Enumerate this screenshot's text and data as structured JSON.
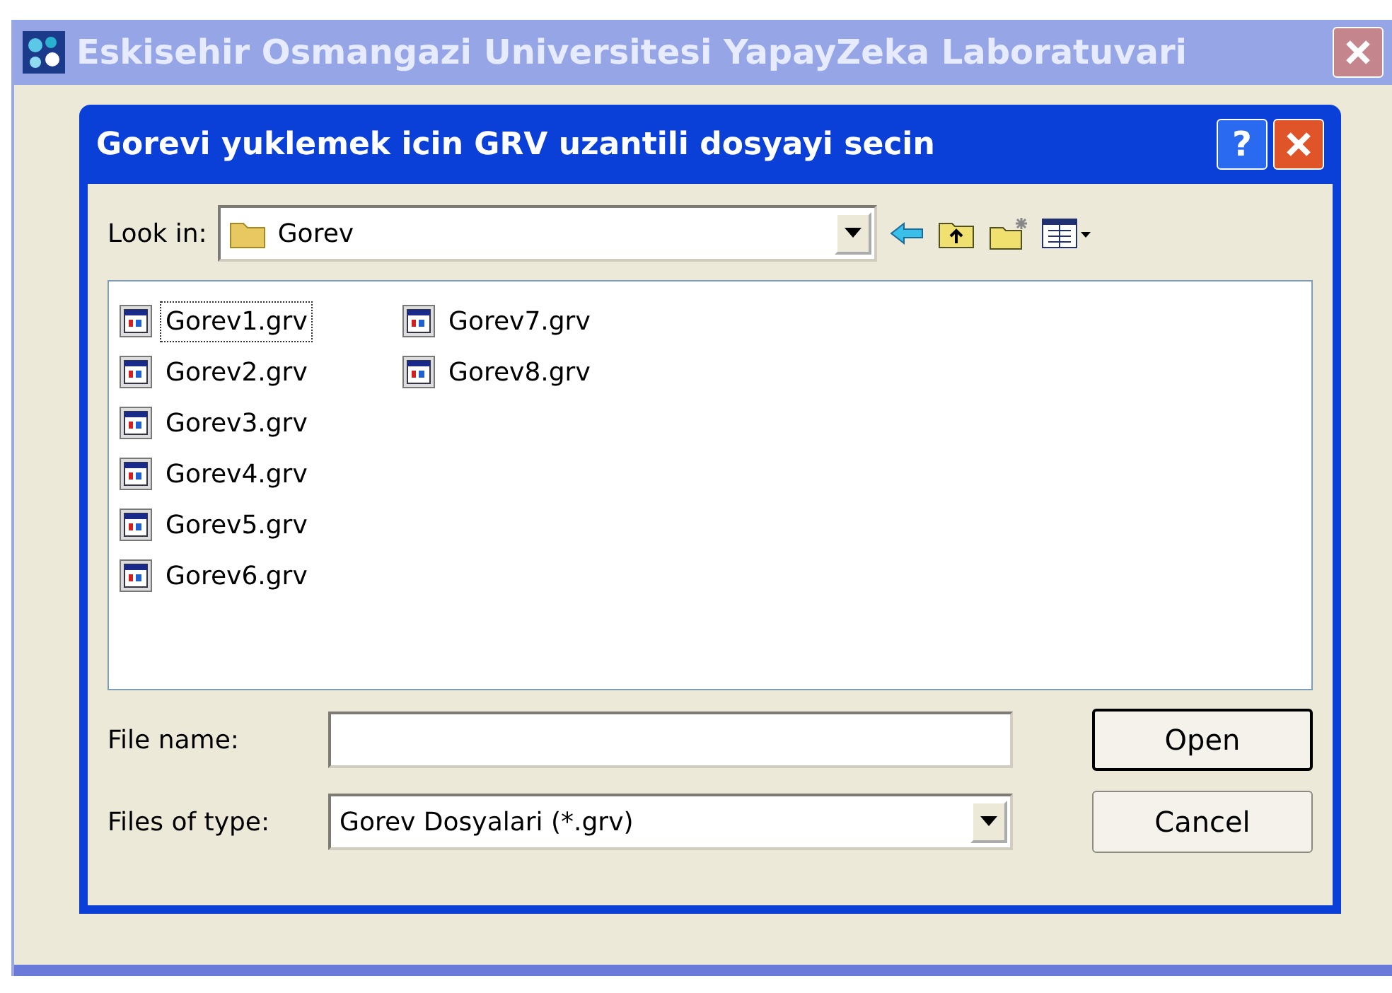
{
  "window": {
    "title": "Eskisehir Osmangazi Universitesi YapayZeka Laboratuvari"
  },
  "dialog": {
    "title": "Gorevi yuklemek icin GRV uzantili dosyayi secin",
    "help_button": "?"
  },
  "look_in": {
    "label": "Look in:",
    "value": "Gorev"
  },
  "files": [
    {
      "name": "Gorev1.grv",
      "selected": true
    },
    {
      "name": "Gorev2.grv",
      "selected": false
    },
    {
      "name": "Gorev3.grv",
      "selected": false
    },
    {
      "name": "Gorev4.grv",
      "selected": false
    },
    {
      "name": "Gorev5.grv",
      "selected": false
    },
    {
      "name": "Gorev6.grv",
      "selected": false
    },
    {
      "name": "Gorev7.grv",
      "selected": false
    },
    {
      "name": "Gorev8.grv",
      "selected": false
    }
  ],
  "file_name": {
    "label": "File name:"
  },
  "file_type": {
    "label": "Files of type:",
    "value": "Gorev Dosyalari (*.grv)"
  },
  "buttons": [
    {
      "label": "Open",
      "default": true
    },
    {
      "label": "Cancel",
      "default": false
    }
  ]
}
